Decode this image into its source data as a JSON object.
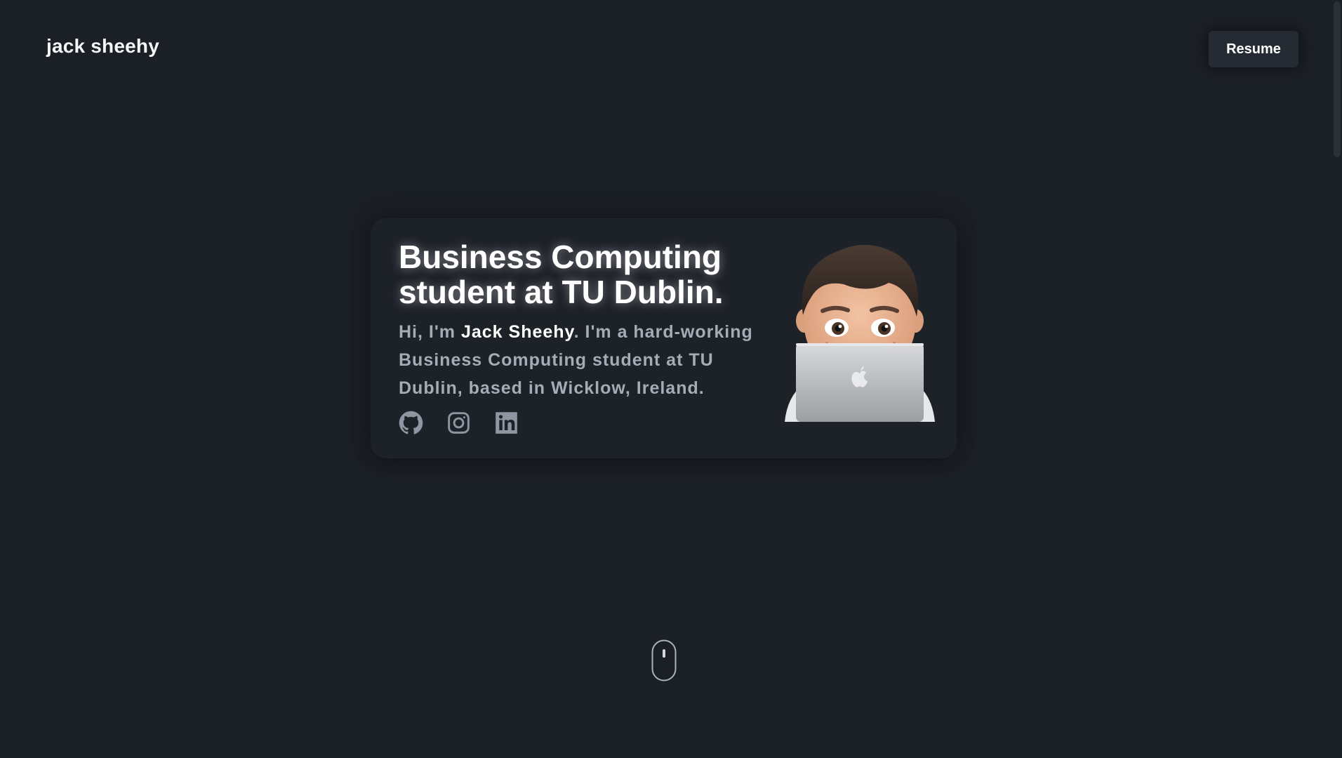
{
  "header": {
    "brand": "jack sheehy",
    "resume_label": "Resume"
  },
  "hero": {
    "headline": "Business Computing student at TU Dublin.",
    "bio_prefix": "Hi, I'm ",
    "bio_name": "Jack Sheehy",
    "bio_suffix": ". I'm a hard-working Business Computing student at TU Dublin, based in Wicklow, Ireland.",
    "socials": [
      {
        "icon": "github-icon"
      },
      {
        "icon": "instagram-icon"
      },
      {
        "icon": "linkedin-icon"
      }
    ],
    "avatar": "memoji-laptop-avatar"
  },
  "colors": {
    "background": "#1b1f26",
    "card": "#1d2128",
    "muted_text": "#a6acb6",
    "icon": "#8f96a1"
  }
}
